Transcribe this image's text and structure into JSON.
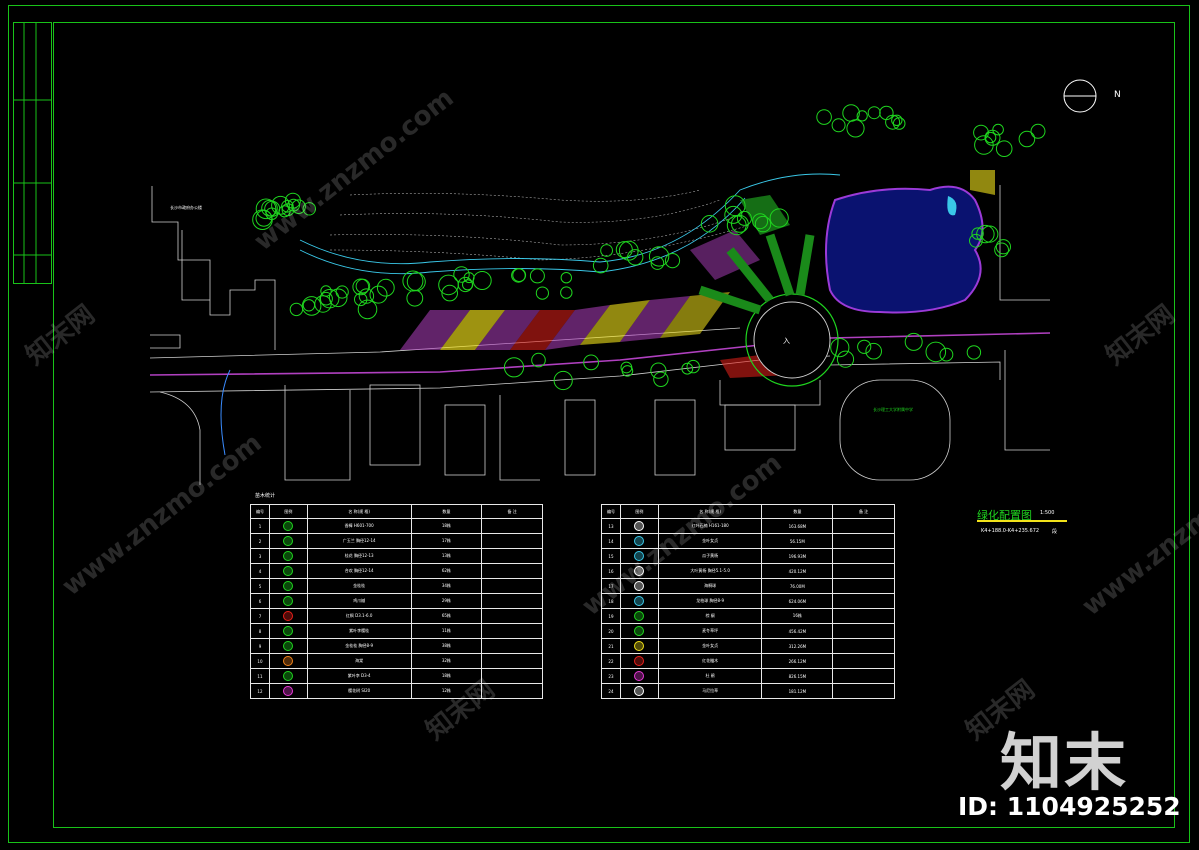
{
  "drawing": {
    "title": "绿化配置图",
    "scale": "1:500",
    "chainage": "K4+188.0-K4+235.672",
    "chainage_suffix": "段",
    "north_label": "N",
    "legend_title": "苗木统计"
  },
  "legend_headers": [
    "编号",
    "图例",
    "名 称(规 格)",
    "数量",
    "备 注"
  ],
  "legend_left": [
    {
      "no": "1",
      "name": "香樟 H601-700",
      "qty": "18株",
      "color": "#1fd51f"
    },
    {
      "no": "2",
      "name": "广玉兰 胸径12-14",
      "qty": "17株",
      "color": "#1fd51f"
    },
    {
      "no": "3",
      "name": "桂花 胸径12-13",
      "qty": "13株",
      "color": "#1fd51f"
    },
    {
      "no": "4",
      "name": "合欢 胸径12-14",
      "qty": "62株",
      "color": "#1fd51f"
    },
    {
      "no": "5",
      "name": "金桂桂",
      "qty": "34株",
      "color": "#1fd51f"
    },
    {
      "no": "6",
      "name": "鸡爪槭",
      "qty": "29株",
      "color": "#1fd51f"
    },
    {
      "no": "7",
      "name": "红枫 D3.1-6.0",
      "qty": "65株",
      "color": "#e8201a"
    },
    {
      "no": "8",
      "name": "紫叶李樱桂",
      "qty": "11株",
      "color": "#1fd51f"
    },
    {
      "no": "9",
      "name": "金桂桂 胸径8-9",
      "qty": "38株",
      "color": "#1fd51f"
    },
    {
      "no": "10",
      "name": "海棠",
      "qty": "32株",
      "color": "#f0821a"
    },
    {
      "no": "11",
      "name": "紫叶李 D3-4",
      "qty": "18株",
      "color": "#1fd51f"
    },
    {
      "no": "12",
      "name": "樱花树 SI20",
      "qty": "12株",
      "color": "#e83ad8"
    }
  ],
  "legend_right": [
    {
      "no": "13",
      "name": "红叶石楠 H161-180",
      "qty": "163.68M",
      "color": "#ffffff"
    },
    {
      "no": "14",
      "name": "金叶女贞",
      "qty": "56.15M",
      "color": "#3ac8e8"
    },
    {
      "no": "15",
      "name": "瓜子黄杨",
      "qty": "196.93M",
      "color": "#3ac8e8"
    },
    {
      "no": "16",
      "name": "大叶黄杨 胸径5.1-5.0",
      "qty": "420.12M",
      "color": "#ffffff"
    },
    {
      "no": "17",
      "name": "海桐球",
      "qty": "76.00M",
      "color": "#ffffff"
    },
    {
      "no": "18",
      "name": "龙柏球 胸径8-9",
      "qty": "624.06M",
      "color": "#3ac8e8"
    },
    {
      "no": "19",
      "name": "棕 榈",
      "qty": "16株",
      "color": "#1fd51f"
    },
    {
      "no": "20",
      "name": "麦冬草坪",
      "qty": "456.42M",
      "color": "#1fd51f"
    },
    {
      "no": "21",
      "name": "金叶女贞",
      "qty": "312.26M",
      "color": "#f2e21a"
    },
    {
      "no": "22",
      "name": "红花檵木",
      "qty": "266.12M",
      "color": "#e8201a"
    },
    {
      "no": "23",
      "name": "杜 鹃",
      "qty": "826.15M",
      "color": "#e83ad8"
    },
    {
      "no": "24",
      "name": "马尼拉草",
      "qty": "181.12M",
      "color": "#ffffff"
    }
  ],
  "site_labels": {
    "plaza": "入",
    "school": "长沙理工大学附属中学",
    "left_building": "长沙市政府办公楼"
  },
  "watermark": {
    "url": "www.znzmo.com",
    "brand_small": "知末网",
    "brand": "知末",
    "id": "ID: 1104925252"
  },
  "colors": {
    "frame": "#19c219",
    "tree": "#1fd51f",
    "pond_fill": "#0a1270",
    "pond_edge": "#9b3ad8",
    "road": "#b040c0",
    "planting_yellow": "#f2e21a",
    "planting_red": "#e8201a",
    "lines": "#ffffff"
  }
}
